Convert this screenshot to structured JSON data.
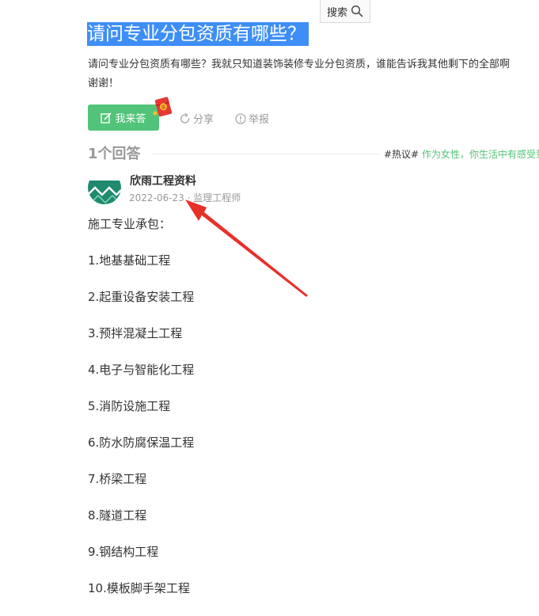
{
  "search": {
    "label": "搜索"
  },
  "question": {
    "title": "请问专业分包资质有哪些？",
    "description_line1": "请问专业分包资质有哪些？我就只知道装饰装修专业分包资质，谁能告诉我其他剩下的全部啊",
    "description_line2": "谢谢！"
  },
  "actions": {
    "answer_label": "我来答",
    "redpacket_char": "奖",
    "share_label": "分享",
    "report_label": "举报"
  },
  "answers": {
    "count_label": "1个回答",
    "hot_tag": "#热议#",
    "hot_text": "作为女性，你生活中有感受到"
  },
  "answer": {
    "author": "欣雨工程资料",
    "date": "2022-06-23",
    "separator": " · ",
    "role": "监理工程师",
    "lines": [
      "施工专业承包：",
      "1.地基基础工程",
      "2.起重设备安装工程",
      "3.预拌混凝土工程",
      "4.电子与智能化工程",
      "5.消防设施工程",
      "6.防水防腐保温工程",
      "7.桥梁工程",
      "8.隧道工程",
      "9.钢结构工程",
      "10.模板脚手架工程"
    ]
  },
  "colors": {
    "title_highlight": "#3e8ef7",
    "accent_green": "#52c479",
    "arrow_red": "#e8302a",
    "avatar_green": "#1f8a6e"
  },
  "icons": [
    "search-icon",
    "edit-icon",
    "red-packet-icon",
    "share-icon",
    "report-icon",
    "arrow-annotation"
  ]
}
